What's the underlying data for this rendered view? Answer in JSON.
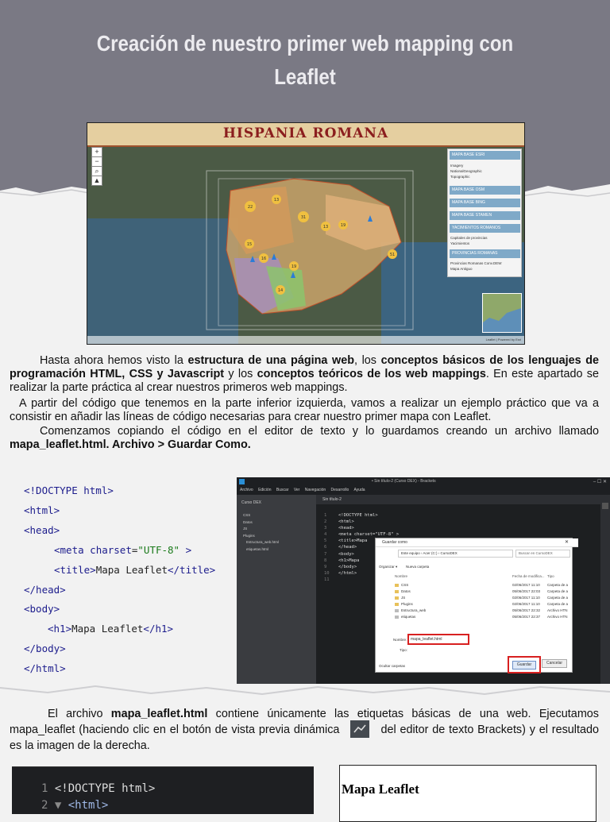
{
  "header": {
    "title": "Creación de nuestro primer web mapping con Leaflet"
  },
  "map": {
    "title": "HISPANIA ROMANA",
    "zoom_in": "+",
    "zoom_out": "−",
    "layer_panel": {
      "buttons": [
        "MAPA BASE ESRI",
        "MAPA BASE OSM",
        "MAPA BASE BING",
        "MAPA BASE STAMEN",
        "YACIMIENTOS ROMANOS",
        "PROVINCIAS ROMANAS"
      ],
      "items": [
        "Imagery",
        "NationalGeographic",
        "Topographic",
        "Capitales de provincias",
        "Yacimientos",
        "Provincias Romanas Conv.DEW",
        "Mapa Antiguo"
      ]
    },
    "cluster_labels": [
      "22",
      "13",
      "31",
      "13",
      "19",
      "15",
      "16",
      "19",
      "14",
      "51"
    ],
    "attribution": "Leaflet | Powered by Esri"
  },
  "intro": {
    "p1_a": "Hasta ahora hemos visto la ",
    "p1_b": "estructura de una página web",
    "p1_c": ", los ",
    "p1_d": "conceptos básicos de los lenguajes de programación HTML, CSS y Javascript",
    "p1_e": " y los ",
    "p1_f": "conceptos teóricos de los web mappings",
    "p1_g": ". En este apartado se realizar la parte práctica al crear nuestros primeros web mappings.",
    "p2": "A partir del código que tenemos en la parte inferior izquierda, vamos a realizar un ejemplo práctico que va a consistir en añadir las líneas de código necesarias para crear nuestro primer mapa con Leaflet.",
    "p3_a": "Comenzamos copiando el código en el editor de texto y lo guardamos creando un archivo llamado ",
    "p3_b": "mapa_leaflet.html.  Archivo > Guardar Como."
  },
  "code_sample": {
    "lines": [
      "<!DOCTYPE html>",
      "<html>",
      "<head>",
      "<meta",
      "charset",
      "\"UTF-8\"",
      ">",
      "<title>",
      "Mapa Leaflet",
      "</title>",
      "</head>",
      "<body>",
      "<h1>",
      "Mapa Leaflet",
      "</h1>",
      "</body>",
      "</html>"
    ]
  },
  "brackets": {
    "window_title": "• Sin título-2 (Curso DEX) - Brackets",
    "menu": [
      "Archivo",
      "Edición",
      "Buscar",
      "Ver",
      "Navegación",
      "Desarrollo",
      "Ayuda"
    ],
    "project": "Curso DEX",
    "tree": [
      "CSS",
      "Datos",
      "JS",
      "Plugins",
      "Estructura_web.html",
      "etiquetas.html"
    ],
    "tab": "Sin título-2",
    "editor_lines": [
      "<!DOCTYPE html>",
      "<html>",
      "<head>",
      "  <meta charset=\"UTF-8\" >",
      "  <title>Mapa",
      "</head>",
      "<body>",
      "  <h1>Mapa",
      "</body>",
      "</html>",
      ""
    ],
    "dialog": {
      "title": "Guardar como",
      "path": "Este equipo › Acer (C:) › CursoDEX",
      "search": "Buscar en CursoDEX",
      "organize": "Organizar ▾",
      "new_folder": "Nueva carpeta",
      "col_name": "Nombre",
      "col_date": "Fecha de modifica...",
      "col_type": "Tipo",
      "files": [
        {
          "name": "CSS",
          "date": "02/06/2017 11:10",
          "type": "Carpeta de a"
        },
        {
          "name": "Datos",
          "date": "05/06/2017 22:03",
          "type": "Carpeta de a"
        },
        {
          "name": "JS",
          "date": "02/06/2017 11:10",
          "type": "Carpeta de a"
        },
        {
          "name": "Plugins",
          "date": "02/06/2017 11:10",
          "type": "Carpeta de a"
        },
        {
          "name": "Estructura_web",
          "date": "05/06/2017 22:32",
          "type": "Archivo HTN"
        },
        {
          "name": "etiquetas",
          "date": "05/06/2017 22:37",
          "type": "Archivo HTN"
        }
      ],
      "name_label": "Nombre:",
      "name_value": "mapa_leaflet.html",
      "type_label": "Tipo:",
      "hide_folders": "Ocultar carpetas",
      "save": "Guardar",
      "cancel": "Cancelar"
    }
  },
  "bottom": {
    "t1": "El archivo ",
    "t2": "mapa_leaflet.html",
    "t3": " contiene únicamente las etiquetas básicas de una web. Ejecutamos mapa_leaflet (haciendo clic en el botón de vista previa dinámica",
    "t4": "del editor de texto Brackets) y el resultado es la imagen de la derecha."
  },
  "code_small": {
    "l1_num": "1",
    "l1": "<!DOCTYPE html>",
    "l2_num": "2 ▼",
    "l2": "<html>"
  },
  "result": {
    "heading": "Mapa Leaflet"
  }
}
